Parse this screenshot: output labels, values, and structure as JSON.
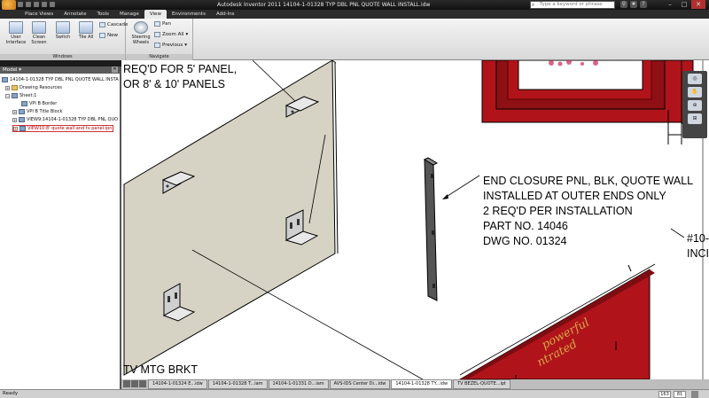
{
  "window": {
    "title": "Autodesk Inventor 2011    14104-1-01328 TYP DBL PNL QUOTE WALL INSTALL.idw",
    "search_placeholder": "Type a keyword or phrase"
  },
  "ribbon": {
    "tabs": [
      {
        "label": "Place Views"
      },
      {
        "label": "Annotate"
      },
      {
        "label": "Tools"
      },
      {
        "label": "Manage"
      },
      {
        "label": "View"
      },
      {
        "label": "Environments"
      },
      {
        "label": "Add-Ins"
      }
    ],
    "active_tab": "View",
    "windows_panel": {
      "title": "Windows",
      "user_interface": "User Interface",
      "clean_screen": "Clean Screen",
      "switch": "Switch",
      "tile_all": "Tile All",
      "cascade": "Cascade",
      "new": "New"
    },
    "navigate_panel": {
      "title": "Navigate",
      "steering_wheels": "Steering Wheels",
      "pan": "Pan",
      "zoom_all": "Zoom All",
      "previous": "Previous"
    }
  },
  "browser": {
    "title": "Model",
    "items": [
      {
        "label": "14104-1-01328 TYP DBL PNL QUOTE WALL INSTA"
      },
      {
        "label": "Drawing Resources"
      },
      {
        "label": "Sheet:1"
      },
      {
        "label": "VPI B Border"
      },
      {
        "label": "VPI B Title Block"
      },
      {
        "label": "VIEW9:14104-1-01328 TYP DBL PNL QUO"
      },
      {
        "label": "VIEW10:8' quote wall and tv panel.ipn"
      }
    ]
  },
  "drawing": {
    "note_top": [
      "REQ'D FOR 5' PANEL,",
      "OR 8' & 10' PANELS"
    ],
    "note_end_closure": [
      "END CLOSURE PNL, BLK, QUOTE WALL",
      "INSTALLED AT OUTER ENDS ONLY",
      "2 REQ'D PER INSTALLATION",
      "PART NO. 14046",
      "DWG NO. 01324"
    ],
    "note_right": [
      "#10-",
      "INCI"
    ],
    "note_bottom": "TV MTG BRKT",
    "panel_text": [
      "powerful",
      "ntrated"
    ]
  },
  "doc_tabs": [
    {
      "label": "14104-1-01324 E...idw"
    },
    {
      "label": "14104-1-01328 T...iam"
    },
    {
      "label": "14104-1-01331 D...iam"
    },
    {
      "label": "AVS-IDS Center Di...idw"
    },
    {
      "label": "14104-1-01328 TY...idw"
    },
    {
      "label": "TV BEZEL-QUOTE...ipt"
    }
  ],
  "status": {
    "text": "Ready",
    "num1": "163",
    "num2": "81"
  },
  "colors": {
    "panel_fill": "#d6d3c4",
    "red_frame": "#b0141a",
    "ribbon_bg": "#e6e6e6"
  }
}
